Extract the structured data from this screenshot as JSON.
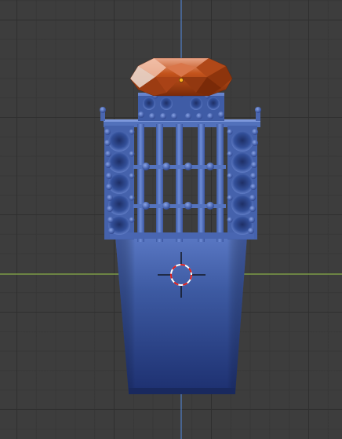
{
  "viewport": {
    "background_color": "#3d3d3d",
    "grid_color": "#2f2f2f",
    "x_axis_color": "#8ab04a",
    "z_axis_color": "#4f7fc8"
  },
  "object": {
    "ring_color": "#4a66b0",
    "gem_color": "#c4541c"
  },
  "icons": {
    "origin": "object-origin-dot-icon",
    "cursor": "3d-cursor-icon"
  }
}
